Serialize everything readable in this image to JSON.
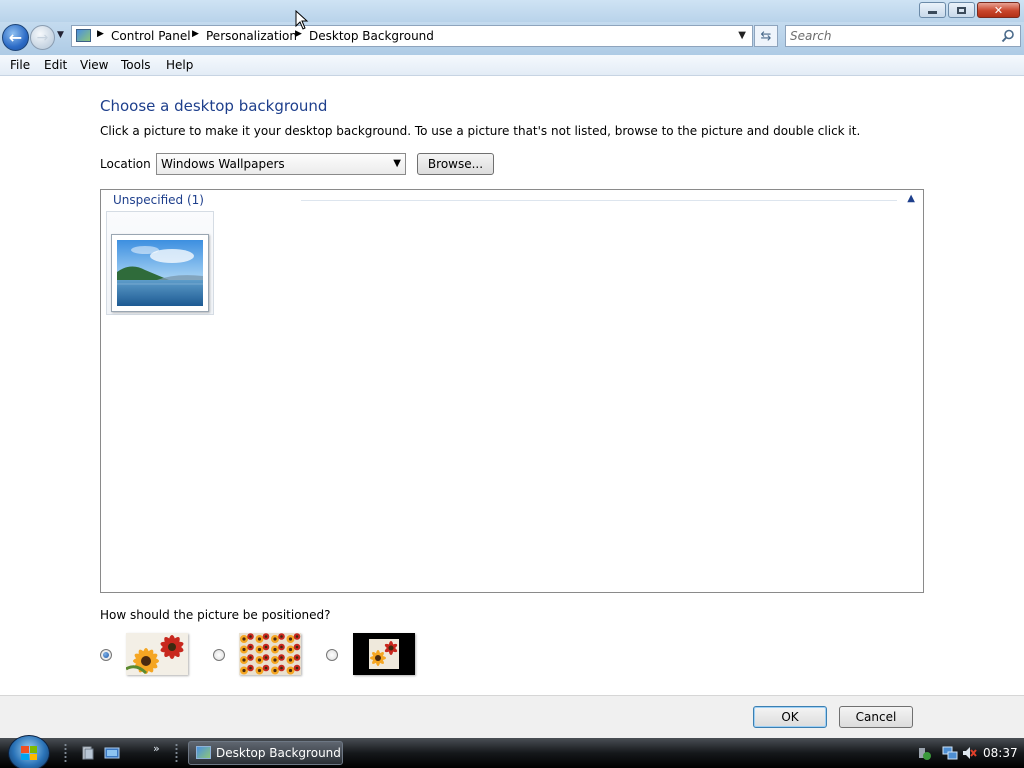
{
  "window": {
    "caption_buttons": {
      "minimize": "minimize-icon",
      "restore": "restore-icon",
      "close": "close-icon"
    }
  },
  "address_bar": {
    "breadcrumbs": [
      "Control Panel",
      "Personalization",
      "Desktop Background"
    ],
    "search_placeholder": "Search"
  },
  "menu": {
    "items": [
      "File",
      "Edit",
      "View",
      "Tools",
      "Help"
    ]
  },
  "main": {
    "title": "Choose a desktop background",
    "instructions": "Click a picture to make it your desktop background. To use a picture that's not listed, browse to the picture and double click it.",
    "location_label": "Location",
    "location_value": "Windows Wallpapers",
    "browse_label": "Browse...",
    "group_label": "Unspecified (1)",
    "position_question": "How should the picture be positioned?",
    "positions": [
      {
        "name": "fit-to-screen",
        "selected": true
      },
      {
        "name": "tile",
        "selected": false
      },
      {
        "name": "center",
        "selected": false
      }
    ]
  },
  "footer": {
    "ok_label": "OK",
    "cancel_label": "Cancel"
  },
  "taskbar": {
    "active_window": "Desktop Background",
    "clock": "08:37"
  },
  "colors": {
    "title_blue": "#1e3f8c",
    "chrome_blue": "#b9d3ea",
    "taskbar": "#15181b"
  }
}
